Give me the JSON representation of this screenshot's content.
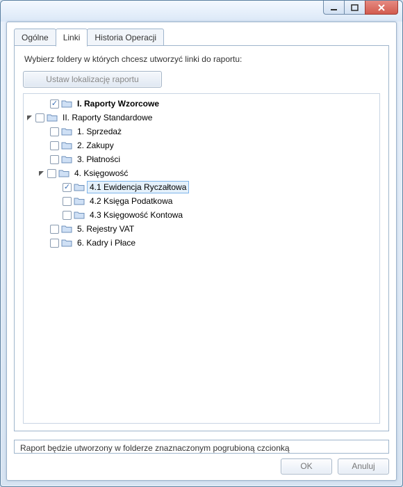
{
  "tabs": {
    "t0": "Ogólne",
    "t1": "Linki",
    "t2": "Historia Operacji",
    "active": 1
  },
  "panel": {
    "instruction": "Wybierz foldery w których chcesz utworzyć linki do raportu:",
    "loc_button": "Ustaw lokalizację raportu",
    "footnote": "Raport będzie utworzony w folderze znaznaczonym pogrubioną czcionką"
  },
  "tree": {
    "n0": "I. Raporty Wzorcowe",
    "n1": "II. Raporty Standardowe",
    "n1_0": "1. Sprzedaż",
    "n1_1": "2. Zakupy",
    "n1_2": "3. Płatności",
    "n1_3": "4. Księgowość",
    "n1_3_0": "4.1 Ewidencja Ryczałtowa",
    "n1_3_1": "4.2 Księga Podatkowa",
    "n1_3_2": "4.3 Księgowość Kontowa",
    "n1_4": "5. Rejestry VAT",
    "n1_5": "6. Kadry i Płace"
  },
  "checked": {
    "n0": true,
    "n1_3_0": true
  },
  "expanded": {
    "n1": true,
    "n1_3": true
  },
  "selected": "n1_3_0",
  "buttons": {
    "ok": "OK",
    "cancel": "Anuluj"
  }
}
